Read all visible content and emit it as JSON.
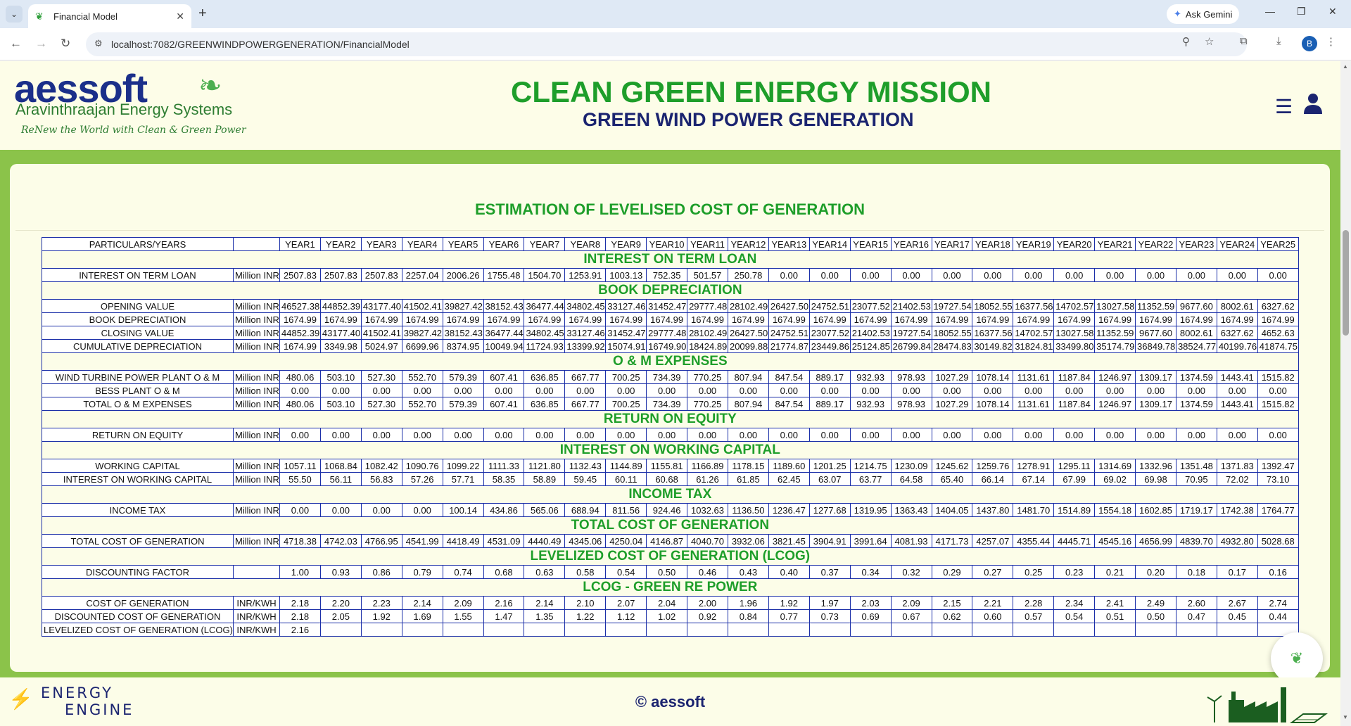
{
  "browser": {
    "tab_title": "Financial Model",
    "url": "localhost:7082/GREENWINDPOWERGENERATION/FinancialModel",
    "ask_gemini": "Ask Gemini",
    "profile_initial": "B"
  },
  "header": {
    "logo_text": "aessoft",
    "logo_sub": "Aravinthraajan Energy Systems",
    "logo_tagline": "ReNew the World with Clean & Green Power",
    "mission": "CLEAN GREEN ENERGY MISSION",
    "subtitle": "GREEN WIND POWER GENERATION"
  },
  "card": {
    "title": "ESTIMATION OF LEVELISED COST OF GENERATION"
  },
  "table": {
    "header": [
      "PARTICULARS/YEARS",
      "",
      "YEAR1",
      "YEAR2",
      "YEAR3",
      "YEAR4",
      "YEAR5",
      "YEAR6",
      "YEAR7",
      "YEAR8",
      "YEAR9",
      "YEAR10",
      "YEAR11",
      "YEAR12",
      "YEAR13",
      "YEAR14",
      "YEAR15",
      "YEAR16",
      "YEAR17",
      "YEAR18",
      "YEAR19",
      "YEAR20",
      "YEAR21",
      "YEAR22",
      "YEAR23",
      "YEAR24",
      "YEAR25"
    ],
    "rows": [
      {
        "section": "INTEREST ON TERM LOAN"
      },
      {
        "label": "INTEREST ON TERM LOAN",
        "unit": "Million INR",
        "values": [
          "2507.83",
          "2507.83",
          "2507.83",
          "2257.04",
          "2006.26",
          "1755.48",
          "1504.70",
          "1253.91",
          "1003.13",
          "752.35",
          "501.57",
          "250.78",
          "0.00",
          "0.00",
          "0.00",
          "0.00",
          "0.00",
          "0.00",
          "0.00",
          "0.00",
          "0.00",
          "0.00",
          "0.00",
          "0.00",
          "0.00"
        ]
      },
      {
        "section": "BOOK DEPRECIATION"
      },
      {
        "label": "OPENING VALUE",
        "unit": "Million INR",
        "values": [
          "46527.38",
          "44852.39",
          "43177.40",
          "41502.41",
          "39827.42",
          "38152.43",
          "36477.44",
          "34802.45",
          "33127.46",
          "31452.47",
          "29777.48",
          "28102.49",
          "26427.50",
          "24752.51",
          "23077.52",
          "21402.53",
          "19727.54",
          "18052.55",
          "16377.56",
          "14702.57",
          "13027.58",
          "11352.59",
          "9677.60",
          "8002.61",
          "6327.62"
        ]
      },
      {
        "label": "BOOK DEPRECIATION",
        "unit": "Million INR",
        "values": [
          "1674.99",
          "1674.99",
          "1674.99",
          "1674.99",
          "1674.99",
          "1674.99",
          "1674.99",
          "1674.99",
          "1674.99",
          "1674.99",
          "1674.99",
          "1674.99",
          "1674.99",
          "1674.99",
          "1674.99",
          "1674.99",
          "1674.99",
          "1674.99",
          "1674.99",
          "1674.99",
          "1674.99",
          "1674.99",
          "1674.99",
          "1674.99",
          "1674.99"
        ]
      },
      {
        "label": "CLOSING VALUE",
        "unit": "Million INR",
        "values": [
          "44852.39",
          "43177.40",
          "41502.41",
          "39827.42",
          "38152.43",
          "36477.44",
          "34802.45",
          "33127.46",
          "31452.47",
          "29777.48",
          "28102.49",
          "26427.50",
          "24752.51",
          "23077.52",
          "21402.53",
          "19727.54",
          "18052.55",
          "16377.56",
          "14702.57",
          "13027.58",
          "11352.59",
          "9677.60",
          "8002.61",
          "6327.62",
          "4652.63"
        ]
      },
      {
        "label": "CUMULATIVE DEPRECIATION",
        "unit": "Million INR",
        "values": [
          "1674.99",
          "3349.98",
          "5024.97",
          "6699.96",
          "8374.95",
          "10049.94",
          "11724.93",
          "13399.92",
          "15074.91",
          "16749.90",
          "18424.89",
          "20099.88",
          "21774.87",
          "23449.86",
          "25124.85",
          "26799.84",
          "28474.83",
          "30149.82",
          "31824.81",
          "33499.80",
          "35174.79",
          "36849.78",
          "38524.77",
          "40199.76",
          "41874.75"
        ]
      },
      {
        "section": "O & M EXPENSES"
      },
      {
        "label": "WIND TURBINE POWER PLANT O & M",
        "unit": "Million INR",
        "values": [
          "480.06",
          "503.10",
          "527.30",
          "552.70",
          "579.39",
          "607.41",
          "636.85",
          "667.77",
          "700.25",
          "734.39",
          "770.25",
          "807.94",
          "847.54",
          "889.17",
          "932.93",
          "978.93",
          "1027.29",
          "1078.14",
          "1131.61",
          "1187.84",
          "1246.97",
          "1309.17",
          "1374.59",
          "1443.41",
          "1515.82"
        ]
      },
      {
        "label": "BESS PLANT O & M",
        "unit": "Million INR",
        "values": [
          "0.00",
          "0.00",
          "0.00",
          "0.00",
          "0.00",
          "0.00",
          "0.00",
          "0.00",
          "0.00",
          "0.00",
          "0.00",
          "0.00",
          "0.00",
          "0.00",
          "0.00",
          "0.00",
          "0.00",
          "0.00",
          "0.00",
          "0.00",
          "0.00",
          "0.00",
          "0.00",
          "0.00",
          "0.00"
        ]
      },
      {
        "label": "TOTAL O & M EXPENSES",
        "unit": "Million INR",
        "values": [
          "480.06",
          "503.10",
          "527.30",
          "552.70",
          "579.39",
          "607.41",
          "636.85",
          "667.77",
          "700.25",
          "734.39",
          "770.25",
          "807.94",
          "847.54",
          "889.17",
          "932.93",
          "978.93",
          "1027.29",
          "1078.14",
          "1131.61",
          "1187.84",
          "1246.97",
          "1309.17",
          "1374.59",
          "1443.41",
          "1515.82"
        ]
      },
      {
        "section": "RETURN ON EQUITY"
      },
      {
        "label": "RETURN ON EQUITY",
        "unit": "Million INR",
        "values": [
          "0.00",
          "0.00",
          "0.00",
          "0.00",
          "0.00",
          "0.00",
          "0.00",
          "0.00",
          "0.00",
          "0.00",
          "0.00",
          "0.00",
          "0.00",
          "0.00",
          "0.00",
          "0.00",
          "0.00",
          "0.00",
          "0.00",
          "0.00",
          "0.00",
          "0.00",
          "0.00",
          "0.00",
          "0.00"
        ]
      },
      {
        "section": "INTEREST ON WORKING CAPITAL"
      },
      {
        "label": "WORKING CAPITAL",
        "unit": "Million INR",
        "values": [
          "1057.11",
          "1068.84",
          "1082.42",
          "1090.76",
          "1099.22",
          "1111.33",
          "1121.80",
          "1132.43",
          "1144.89",
          "1155.81",
          "1166.89",
          "1178.15",
          "1189.60",
          "1201.25",
          "1214.75",
          "1230.09",
          "1245.62",
          "1259.76",
          "1278.91",
          "1295.11",
          "1314.69",
          "1332.96",
          "1351.48",
          "1371.83",
          "1392.47"
        ]
      },
      {
        "label": "INTEREST ON WORKING CAPITAL",
        "unit": "Million INR",
        "values": [
          "55.50",
          "56.11",
          "56.83",
          "57.26",
          "57.71",
          "58.35",
          "58.89",
          "59.45",
          "60.11",
          "60.68",
          "61.26",
          "61.85",
          "62.45",
          "63.07",
          "63.77",
          "64.58",
          "65.40",
          "66.14",
          "67.14",
          "67.99",
          "69.02",
          "69.98",
          "70.95",
          "72.02",
          "73.10"
        ]
      },
      {
        "section": "INCOME TAX"
      },
      {
        "label": "INCOME TAX",
        "unit": "Million INR",
        "values": [
          "0.00",
          "0.00",
          "0.00",
          "0.00",
          "100.14",
          "434.86",
          "565.06",
          "688.94",
          "811.56",
          "924.46",
          "1032.63",
          "1136.50",
          "1236.47",
          "1277.68",
          "1319.95",
          "1363.43",
          "1404.05",
          "1437.80",
          "1481.70",
          "1514.89",
          "1554.18",
          "1602.85",
          "1719.17",
          "1742.38",
          "1764.77"
        ]
      },
      {
        "section": "TOTAL COST OF GENERATION"
      },
      {
        "label": "TOTAL COST OF GENERATION",
        "unit": "Million INR",
        "values": [
          "4718.38",
          "4742.03",
          "4766.95",
          "4541.99",
          "4418.49",
          "4531.09",
          "4440.49",
          "4345.06",
          "4250.04",
          "4146.87",
          "4040.70",
          "3932.06",
          "3821.45",
          "3904.91",
          "3991.64",
          "4081.93",
          "4171.73",
          "4257.07",
          "4355.44",
          "4445.71",
          "4545.16",
          "4656.99",
          "4839.70",
          "4932.80",
          "5028.68"
        ]
      },
      {
        "section": "LEVELIZED COST OF GENERATION (LCOG)"
      },
      {
        "label": "DISCOUNTING FACTOR",
        "unit": "",
        "values": [
          "1.00",
          "0.93",
          "0.86",
          "0.79",
          "0.74",
          "0.68",
          "0.63",
          "0.58",
          "0.54",
          "0.50",
          "0.46",
          "0.43",
          "0.40",
          "0.37",
          "0.34",
          "0.32",
          "0.29",
          "0.27",
          "0.25",
          "0.23",
          "0.21",
          "0.20",
          "0.18",
          "0.17",
          "0.16"
        ]
      },
      {
        "section": "LCOG - GREEN RE POWER"
      },
      {
        "label": "COST OF GENERATION",
        "unit": "INR/KWH",
        "values": [
          "2.18",
          "2.20",
          "2.23",
          "2.14",
          "2.09",
          "2.16",
          "2.14",
          "2.10",
          "2.07",
          "2.04",
          "2.00",
          "1.96",
          "1.92",
          "1.97",
          "2.03",
          "2.09",
          "2.15",
          "2.21",
          "2.28",
          "2.34",
          "2.41",
          "2.49",
          "2.60",
          "2.67",
          "2.74"
        ]
      },
      {
        "label": "DISCOUNTED COST OF GENERATION",
        "unit": "INR/KWH",
        "values": [
          "2.18",
          "2.05",
          "1.92",
          "1.69",
          "1.55",
          "1.47",
          "1.35",
          "1.22",
          "1.12",
          "1.02",
          "0.92",
          "0.84",
          "0.77",
          "0.73",
          "0.69",
          "0.67",
          "0.62",
          "0.60",
          "0.57",
          "0.54",
          "0.51",
          "0.50",
          "0.47",
          "0.45",
          "0.44"
        ]
      },
      {
        "label": "LEVELIZED COST OF GENERATION (LCOG)",
        "unit": "INR/KWH",
        "values": [
          "2.16",
          "",
          "",
          "",
          "",
          "",
          "",
          "",
          "",
          "",
          "",
          "",
          "",
          "",
          "",
          "",
          "",
          "",
          "",
          "",
          "",
          "",
          "",
          "",
          ""
        ]
      }
    ]
  },
  "footer": {
    "brand_line1": "ENERGY",
    "brand_line2": "ENGINE",
    "copyright": "© aessoft"
  }
}
